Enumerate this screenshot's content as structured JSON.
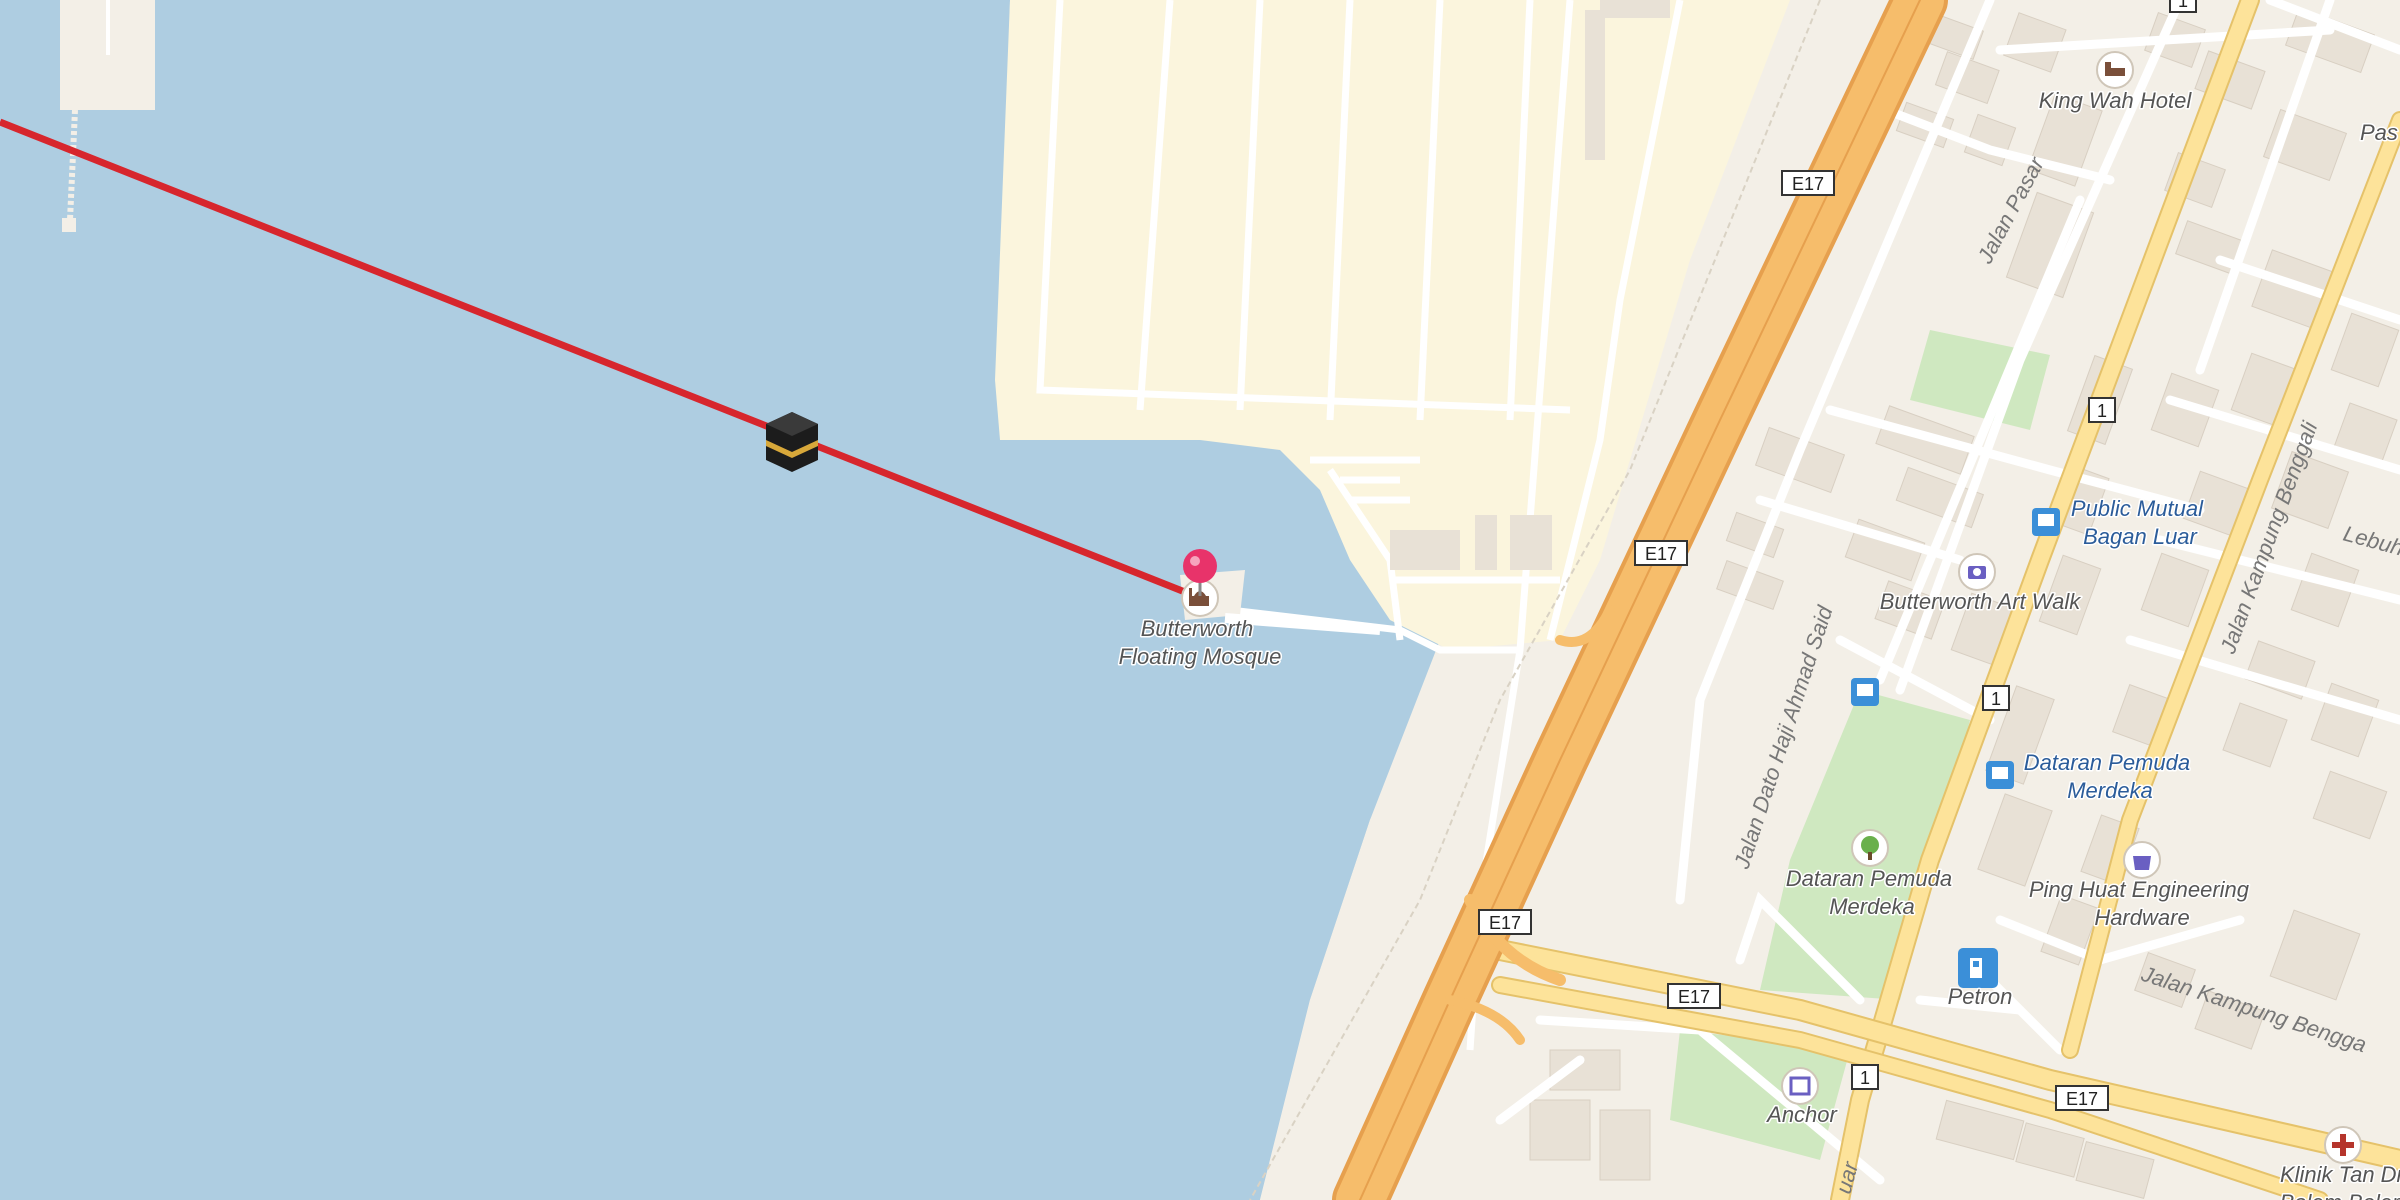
{
  "map": {
    "pois": {
      "mosque": "Butterworth\nFloating Mosque",
      "hotel": "King Wah Hotel",
      "bank": "Public Mutual\nBagan Luar",
      "artwalk": "Butterworth Art Walk",
      "bus_stop": "Dataran Pemuda\nMerdeka",
      "park": "Dataran Pemuda\nMerdeka",
      "hardware": "Ping Huat Engineering\nHardware",
      "petrol": "Petron",
      "anchor": "Anchor",
      "clinic": "Klinik Tan Dr\nBolem Bolem",
      "pas": "Pas"
    },
    "roads": {
      "jalan_pasar": "Jalan Pasar",
      "dato_haji": "Jalan Dato Haji Ahmad Said",
      "kampung_benggali": "Jalan Kampung Benggali",
      "kampung_benggali2": "Jalan Kampung Bengga",
      "lebuh": "Lebuh",
      "luar": "uar"
    },
    "shields": {
      "e17_a": "E17",
      "e17_b": "E17",
      "e17_c": "E17",
      "e17_d": "E17",
      "e17_e": "E17",
      "r1_a": "1",
      "r1_b": "1",
      "r1_c": "1",
      "r1_d": "1"
    },
    "colors": {
      "water": "#aecde1",
      "land": "#f3efe7",
      "reclaimed": "#fbf5dd",
      "motorway": "#f6bd6b",
      "primary": "#fde39a",
      "park": "#cfe8c0",
      "qibla_line": "#d7262d",
      "pin": "#e8336a"
    },
    "icons": {
      "kaaba": "kaaba-icon",
      "pin": "location-pin-icon"
    }
  }
}
